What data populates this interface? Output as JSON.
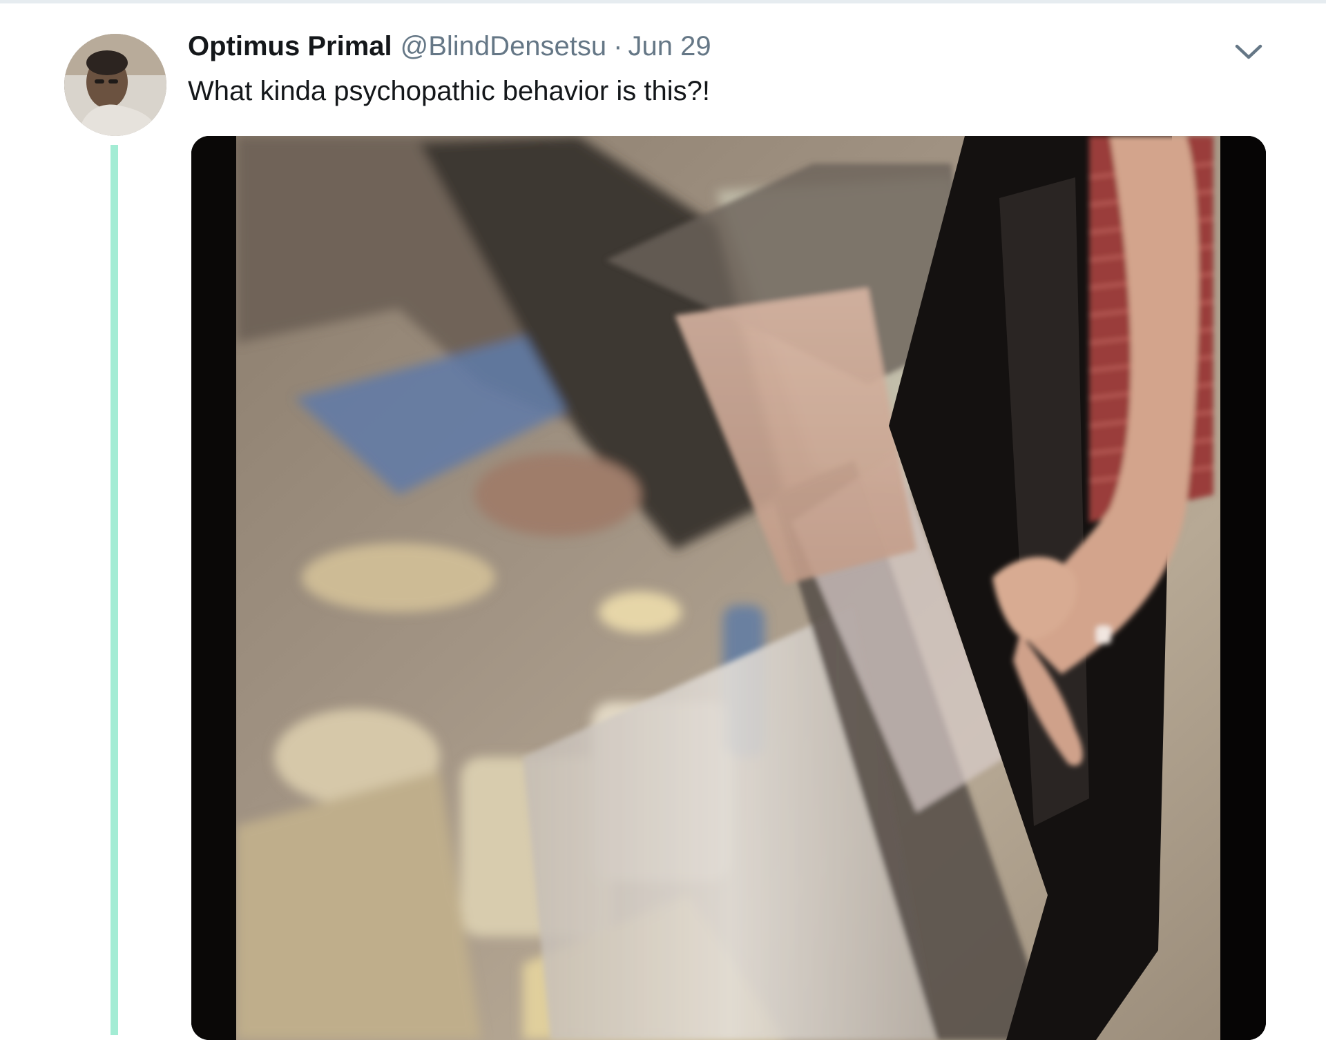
{
  "tweet": {
    "display_name": "Optimus Primal",
    "handle": "@BlindDensetsu",
    "separator": "·",
    "timestamp": "Jun 29",
    "text": "What kinda psychopathic behavior is this?!",
    "avatar_icon": "user-avatar-photo",
    "caret_icon": "chevron-down-icon",
    "media_type": "video-still"
  },
  "colors": {
    "name": "#14171a",
    "secondary": "#657786",
    "thread_line": "#a3ecd4"
  }
}
